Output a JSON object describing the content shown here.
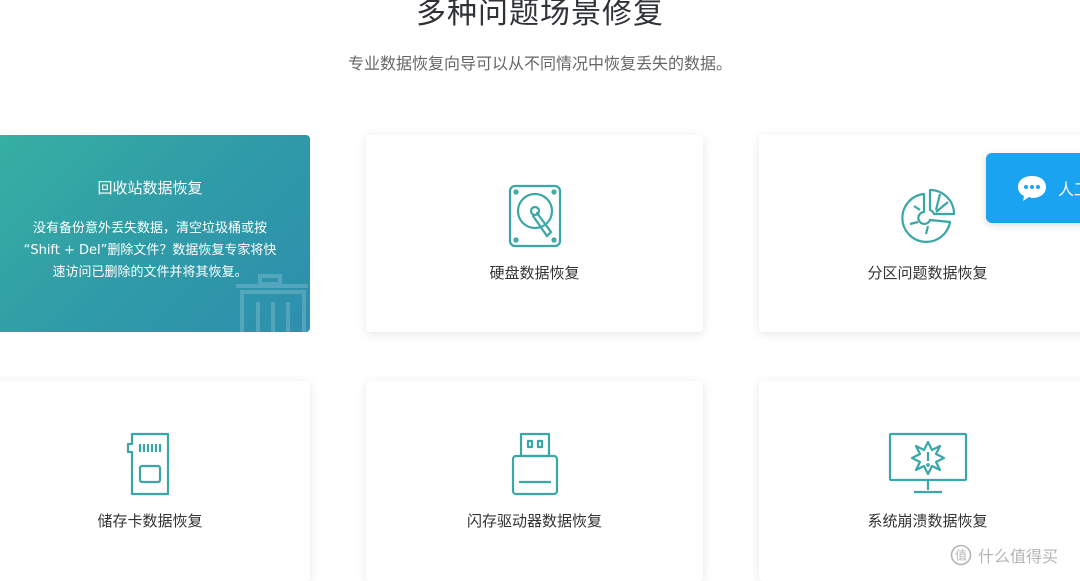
{
  "header": {
    "title": "多种问题场景修复",
    "subtitle": "专业数据恢复向导可以从不同情况中恢复丢失的数据。"
  },
  "cards": [
    {
      "label": "回收站数据恢复",
      "description_line1": "没有备份意外丢失数据，清空垃圾桶或按",
      "description_line2": "“Shift + Del”删除文件？数据恢复专家将快",
      "description_line3": "速访问已删除的文件并将其恢复。",
      "icon": "trash-bin-icon",
      "active": true
    },
    {
      "label": "硬盘数据恢复",
      "icon": "hard-disk-icon"
    },
    {
      "label": "分区问题数据恢复",
      "icon": "partition-pie-icon"
    },
    {
      "label": "储存卡数据恢复",
      "icon": "sd-card-icon"
    },
    {
      "label": "闪存驱动器数据恢复",
      "icon": "usb-drive-icon"
    },
    {
      "label": "系统崩溃数据恢复",
      "icon": "system-crash-monitor-icon"
    }
  ],
  "chat": {
    "label": "人工",
    "icon": "chat-bubble-icon"
  },
  "watermark": {
    "text": "什么值得买",
    "icon": "smzdm-logo-icon"
  },
  "colors": {
    "accent": "#36b0a2",
    "accent_dark": "#2e8fae",
    "icon_stroke": "#3aa7a7",
    "chat": "#1aa3f0"
  }
}
